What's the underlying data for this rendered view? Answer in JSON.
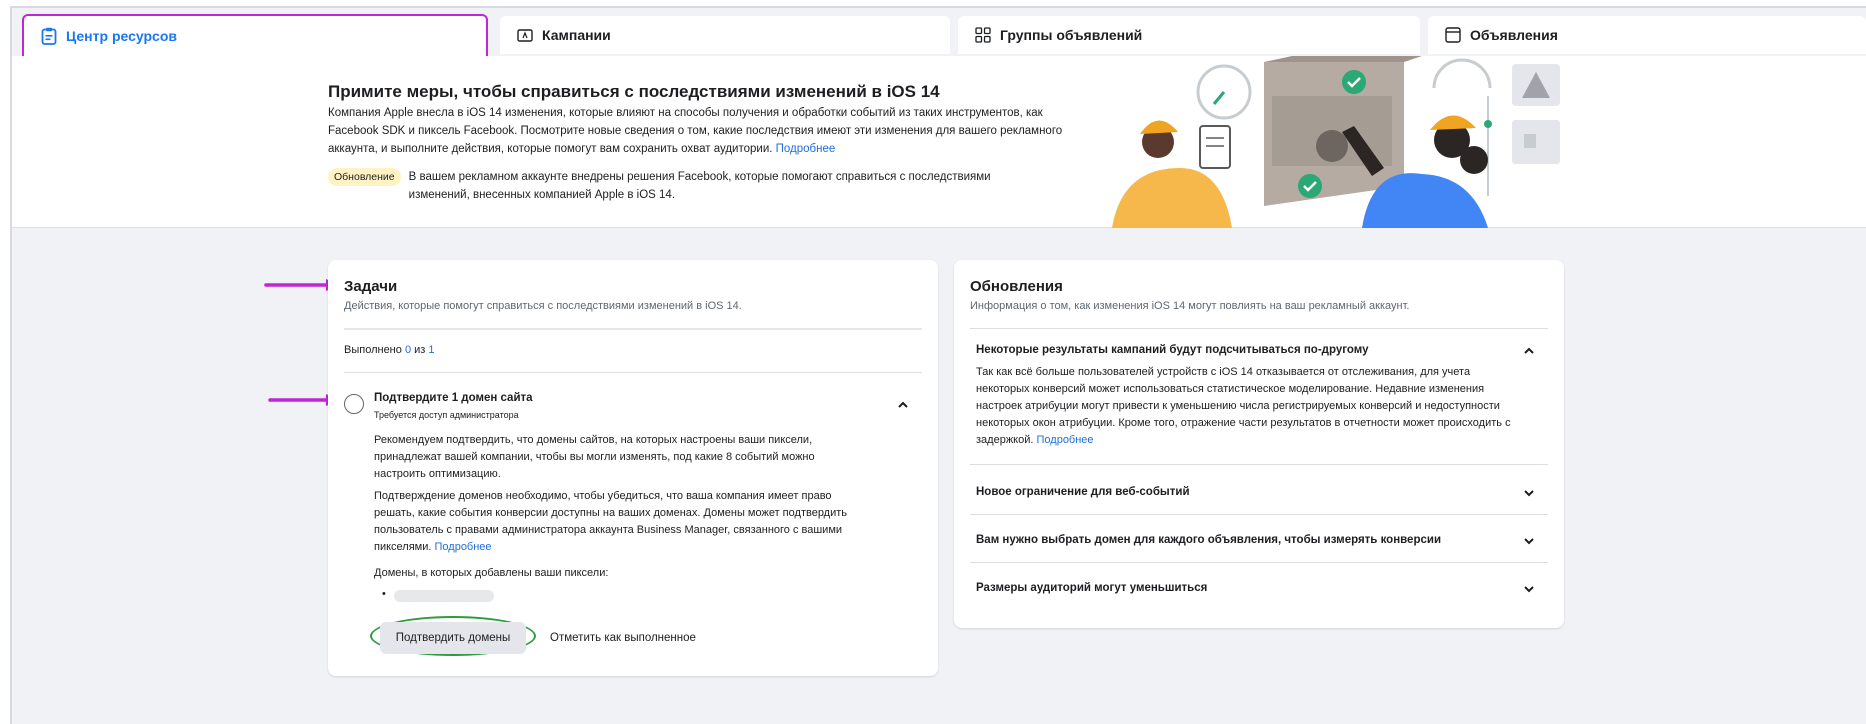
{
  "tabs": [
    {
      "label": "Центр ресурсов",
      "icon": "clipboard-icon",
      "active": true
    },
    {
      "label": "Кампании",
      "icon": "folder-icon",
      "active": false
    },
    {
      "label": "Группы объявлений",
      "icon": "grid-icon",
      "active": false
    },
    {
      "label": "Объявления",
      "icon": "ad-icon",
      "active": false
    }
  ],
  "banner": {
    "title": "Примите меры, чтобы справиться с последствиями изменений в iOS 14",
    "text": "Компания Apple внесла в iOS 14 изменения, которые влияют на способы получения и обработки событий из таких инструментов, как Facebook SDK и пиксель Facebook. Посмотрите новые сведения о том, какие последствия имеют эти изменения для вашего рекламного аккаунта, и выполните действия, которые помогут вам сохранить охват аудитории.",
    "learn_more": "Подробнее",
    "update_badge": "Обновление",
    "update_text": "В вашем рекламном аккаунте внедрены решения Facebook, которые помогают справиться с последствиями изменений, внесенных компанией Apple в iOS 14."
  },
  "tasks": {
    "title": "Задачи",
    "subtitle": "Действия, которые помогут справиться с последствиями изменений в iOS 14.",
    "progress_label": "Выполнено",
    "progress_done": "0",
    "progress_of": "из",
    "progress_total": "1",
    "item": {
      "title": "Подтвердите 1 домен сайта",
      "subtitle": "Требуется доступ администратора",
      "para1": "Рекомендуем подтвердить, что домены сайтов, на которых настроены ваши пиксели, принадлежат вашей компании, чтобы вы могли изменять, под какие 8 событий можно настроить оптимизацию.",
      "para2": "Подтверждение доменов необходимо, чтобы убедиться, что ваша компания имеет право решать, какие события конверсии доступны на ваших доменах. Домены может подтвердить пользователь с правами администратора аккаунта Business Manager, связанного с вашими пикселями.",
      "learn_more": "Подробнее",
      "domains_label": "Домены, в которых добавлены ваши пиксели:",
      "confirm_button": "Подтвердить домены",
      "mark_done_button": "Отметить как выполненное"
    }
  },
  "updates": {
    "title": "Обновления",
    "subtitle": "Информация о том, как изменения iOS 14 могут повлиять на ваш рекламный аккаунт.",
    "items": [
      {
        "title": "Некоторые результаты кампаний будут подсчитываться по-другому",
        "expanded": true,
        "body": "Так как всё больше пользователей устройств с iOS 14 отказывается от отслеживания, для учета некоторых конверсий может использоваться статистическое моделирование. Недавние изменения настроек атрибуции могут привести к уменьшению числа регистрируемых конверсий и недоступности некоторых окон атрибуции. Кроме того, отражение части результатов в отчетности может происходить с задержкой.",
        "learn_more": "Подробнее"
      },
      {
        "title": "Новое ограничение для веб-событий",
        "expanded": false
      },
      {
        "title": "Вам нужно выбрать домен для каждого объявления, чтобы измерять конверсии",
        "expanded": false
      },
      {
        "title": "Размеры аудиторий могут уменьшиться",
        "expanded": false
      }
    ]
  },
  "colors": {
    "accent": "#1877f2",
    "highlight": "#c026d3",
    "ellipse": "#2e9b3c",
    "badge": "#fff3c4"
  }
}
